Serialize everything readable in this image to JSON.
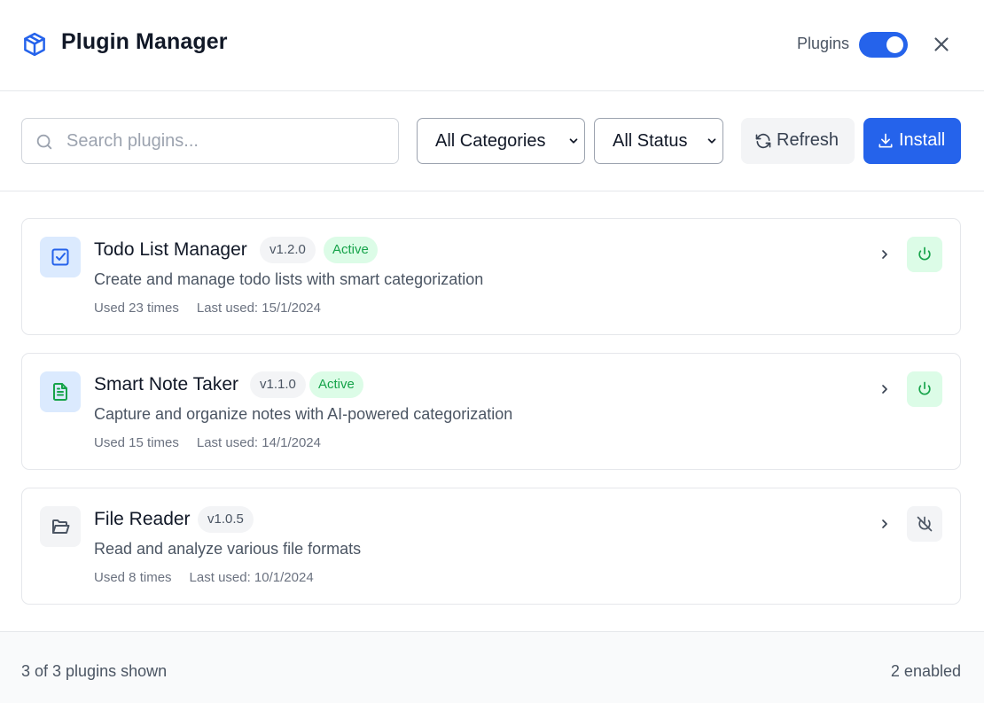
{
  "header": {
    "title": "Plugin Manager",
    "toggle_label": "Plugins",
    "toggle_on": true
  },
  "toolbar": {
    "search_placeholder": "Search plugins...",
    "search_value": "",
    "category_selected": "All Categories",
    "status_selected": "All Status",
    "refresh_label": "Refresh",
    "install_label": "Install"
  },
  "plugins": [
    {
      "name": "Todo List Manager",
      "version": "v1.2.0",
      "status": "Active",
      "description": "Create and manage todo lists with smart categorization",
      "used": "Used 23 times",
      "last_used": "Last used: 15/1/2024",
      "icon": "checkbox-icon",
      "enabled": true
    },
    {
      "name": "Smart Note Taker",
      "version": "v1.1.0",
      "status": "Active",
      "description": "Capture and organize notes with AI-powered categorization",
      "used": "Used 15 times",
      "last_used": "Last used: 14/1/2024",
      "icon": "document-icon",
      "enabled": true
    },
    {
      "name": "File Reader",
      "version": "v1.0.5",
      "status": "",
      "description": "Read and analyze various file formats",
      "used": "Used 8 times",
      "last_used": "Last used: 10/1/2024",
      "icon": "folder-open-icon",
      "enabled": false
    }
  ],
  "footer": {
    "shown": "3 of 3 plugins shown",
    "enabled": "2 enabled"
  },
  "colors": {
    "accent": "#2563eb",
    "active_bg": "#dcfce7",
    "active_text": "#16a34a"
  }
}
